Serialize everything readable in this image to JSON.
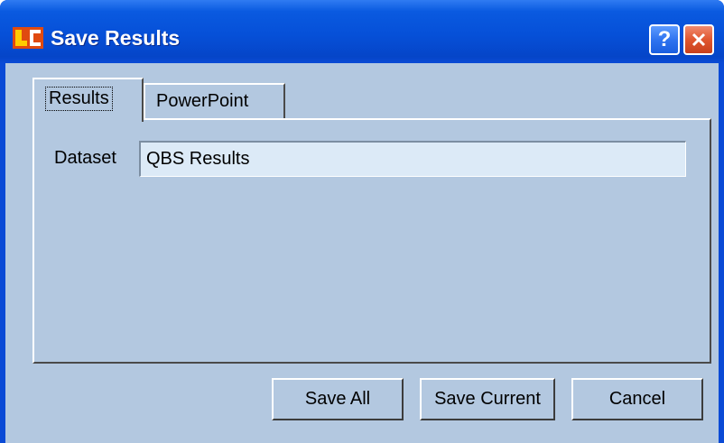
{
  "window": {
    "title": "Save Results",
    "icon": "app-logo-icon",
    "help_glyph": "?",
    "help_icon": "question-mark-icon",
    "close_icon": "close-x-icon"
  },
  "tabs": [
    {
      "label": "Results",
      "active": true
    },
    {
      "label": "PowerPoint",
      "active": false
    }
  ],
  "form": {
    "dataset_label": "Dataset",
    "dataset_value": "QBS Results"
  },
  "buttons": {
    "save_all": "Save All",
    "save_current": "Save Current",
    "cancel": "Cancel"
  },
  "colors": {
    "titlebar": "#0650d8",
    "client_background": "#b3c8e0",
    "input_background": "#dceaf7",
    "close_button": "#e0562f"
  }
}
